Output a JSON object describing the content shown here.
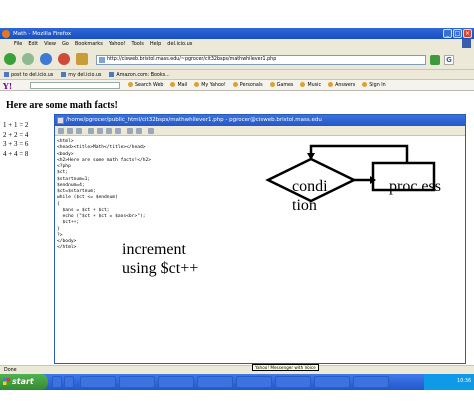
{
  "browser": {
    "window_title": "Math - Mozilla Firefox",
    "menu": [
      "File",
      "Edit",
      "View",
      "Go",
      "Bookmarks",
      "Yahoo!",
      "Tools",
      "Help",
      "del.icio.us"
    ],
    "url": "http://cisweb.bristol.mass.edu/~pgrocer/cit32bsps/mathwhilever1.php",
    "bookmarks": [
      "post to del.icio.us",
      "my del.icio.us",
      "Amazon.com: Books..."
    ],
    "yahoo_toolbar": {
      "logo": "Y!",
      "items": [
        "Search Web",
        "Mail",
        "My Yahoo!",
        "Personals",
        "Games",
        "Music",
        "Answers",
        "Sign In"
      ]
    },
    "status": "Done"
  },
  "page": {
    "heading": "Here are some math facts!",
    "facts": [
      "1 + 1 = 2",
      "2 + 2 = 4",
      "3 + 3 = 6",
      "4 + 4 = 8"
    ]
  },
  "editor": {
    "title": "/home/pgrocer/public_html/cit32bsps/mathwhilever1.php - pgrocer@cisweb.bristol.mass.edu",
    "code_lines": [
      "<html>",
      "<head><title>Math</title></head>",
      "<body>",
      "<h2>Here are some math facts!</h2>",
      "<?php",
      "$ct;",
      "$startnum=1;",
      "$endnum=4;",
      "$ct=$startnum;",
      "while ($ct <= $endnum)",
      "{",
      "  $ans = $ct + $ct;",
      "  echo (\"$ct + $ct = $ans<br>\");",
      "  $ct++;",
      "}",
      "?>",
      "</body>",
      "</html>"
    ]
  },
  "annotations": {
    "increment": "increment using $ct++",
    "condition": "condi tion",
    "process": "proc ess"
  },
  "taskbar": {
    "start_label": "start",
    "tooltip": "Yahoo! Messenger with Voice",
    "clock": "10:36"
  }
}
